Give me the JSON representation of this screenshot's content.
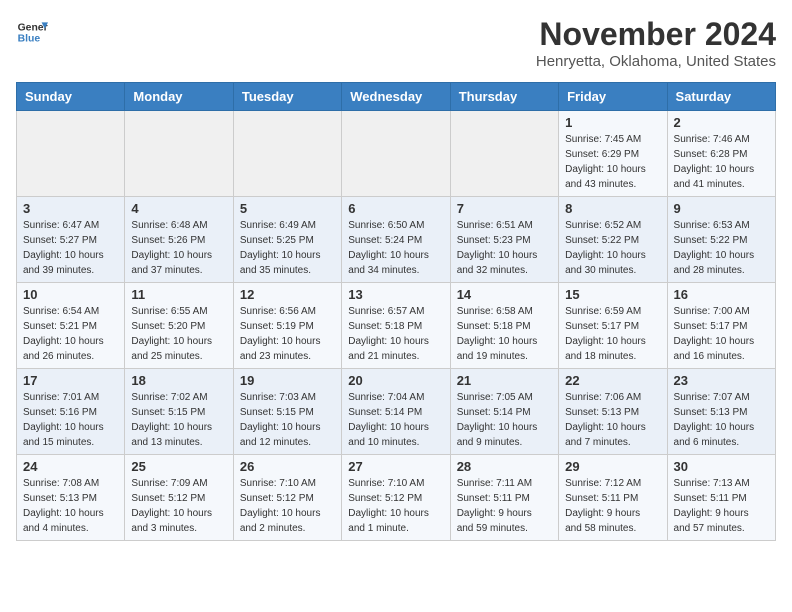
{
  "logo": {
    "line1": "General",
    "line2": "Blue"
  },
  "title": "November 2024",
  "subtitle": "Henryetta, Oklahoma, United States",
  "headers": [
    "Sunday",
    "Monday",
    "Tuesday",
    "Wednesday",
    "Thursday",
    "Friday",
    "Saturday"
  ],
  "weeks": [
    [
      {
        "day": "",
        "info": ""
      },
      {
        "day": "",
        "info": ""
      },
      {
        "day": "",
        "info": ""
      },
      {
        "day": "",
        "info": ""
      },
      {
        "day": "",
        "info": ""
      },
      {
        "day": "1",
        "info": "Sunrise: 7:45 AM\nSunset: 6:29 PM\nDaylight: 10 hours\nand 43 minutes."
      },
      {
        "day": "2",
        "info": "Sunrise: 7:46 AM\nSunset: 6:28 PM\nDaylight: 10 hours\nand 41 minutes."
      }
    ],
    [
      {
        "day": "3",
        "info": "Sunrise: 6:47 AM\nSunset: 5:27 PM\nDaylight: 10 hours\nand 39 minutes."
      },
      {
        "day": "4",
        "info": "Sunrise: 6:48 AM\nSunset: 5:26 PM\nDaylight: 10 hours\nand 37 minutes."
      },
      {
        "day": "5",
        "info": "Sunrise: 6:49 AM\nSunset: 5:25 PM\nDaylight: 10 hours\nand 35 minutes."
      },
      {
        "day": "6",
        "info": "Sunrise: 6:50 AM\nSunset: 5:24 PM\nDaylight: 10 hours\nand 34 minutes."
      },
      {
        "day": "7",
        "info": "Sunrise: 6:51 AM\nSunset: 5:23 PM\nDaylight: 10 hours\nand 32 minutes."
      },
      {
        "day": "8",
        "info": "Sunrise: 6:52 AM\nSunset: 5:22 PM\nDaylight: 10 hours\nand 30 minutes."
      },
      {
        "day": "9",
        "info": "Sunrise: 6:53 AM\nSunset: 5:22 PM\nDaylight: 10 hours\nand 28 minutes."
      }
    ],
    [
      {
        "day": "10",
        "info": "Sunrise: 6:54 AM\nSunset: 5:21 PM\nDaylight: 10 hours\nand 26 minutes."
      },
      {
        "day": "11",
        "info": "Sunrise: 6:55 AM\nSunset: 5:20 PM\nDaylight: 10 hours\nand 25 minutes."
      },
      {
        "day": "12",
        "info": "Sunrise: 6:56 AM\nSunset: 5:19 PM\nDaylight: 10 hours\nand 23 minutes."
      },
      {
        "day": "13",
        "info": "Sunrise: 6:57 AM\nSunset: 5:18 PM\nDaylight: 10 hours\nand 21 minutes."
      },
      {
        "day": "14",
        "info": "Sunrise: 6:58 AM\nSunset: 5:18 PM\nDaylight: 10 hours\nand 19 minutes."
      },
      {
        "day": "15",
        "info": "Sunrise: 6:59 AM\nSunset: 5:17 PM\nDaylight: 10 hours\nand 18 minutes."
      },
      {
        "day": "16",
        "info": "Sunrise: 7:00 AM\nSunset: 5:17 PM\nDaylight: 10 hours\nand 16 minutes."
      }
    ],
    [
      {
        "day": "17",
        "info": "Sunrise: 7:01 AM\nSunset: 5:16 PM\nDaylight: 10 hours\nand 15 minutes."
      },
      {
        "day": "18",
        "info": "Sunrise: 7:02 AM\nSunset: 5:15 PM\nDaylight: 10 hours\nand 13 minutes."
      },
      {
        "day": "19",
        "info": "Sunrise: 7:03 AM\nSunset: 5:15 PM\nDaylight: 10 hours\nand 12 minutes."
      },
      {
        "day": "20",
        "info": "Sunrise: 7:04 AM\nSunset: 5:14 PM\nDaylight: 10 hours\nand 10 minutes."
      },
      {
        "day": "21",
        "info": "Sunrise: 7:05 AM\nSunset: 5:14 PM\nDaylight: 10 hours\nand 9 minutes."
      },
      {
        "day": "22",
        "info": "Sunrise: 7:06 AM\nSunset: 5:13 PM\nDaylight: 10 hours\nand 7 minutes."
      },
      {
        "day": "23",
        "info": "Sunrise: 7:07 AM\nSunset: 5:13 PM\nDaylight: 10 hours\nand 6 minutes."
      }
    ],
    [
      {
        "day": "24",
        "info": "Sunrise: 7:08 AM\nSunset: 5:13 PM\nDaylight: 10 hours\nand 4 minutes."
      },
      {
        "day": "25",
        "info": "Sunrise: 7:09 AM\nSunset: 5:12 PM\nDaylight: 10 hours\nand 3 minutes."
      },
      {
        "day": "26",
        "info": "Sunrise: 7:10 AM\nSunset: 5:12 PM\nDaylight: 10 hours\nand 2 minutes."
      },
      {
        "day": "27",
        "info": "Sunrise: 7:10 AM\nSunset: 5:12 PM\nDaylight: 10 hours\nand 1 minute."
      },
      {
        "day": "28",
        "info": "Sunrise: 7:11 AM\nSunset: 5:11 PM\nDaylight: 9 hours\nand 59 minutes."
      },
      {
        "day": "29",
        "info": "Sunrise: 7:12 AM\nSunset: 5:11 PM\nDaylight: 9 hours\nand 58 minutes."
      },
      {
        "day": "30",
        "info": "Sunrise: 7:13 AM\nSunset: 5:11 PM\nDaylight: 9 hours\nand 57 minutes."
      }
    ]
  ]
}
